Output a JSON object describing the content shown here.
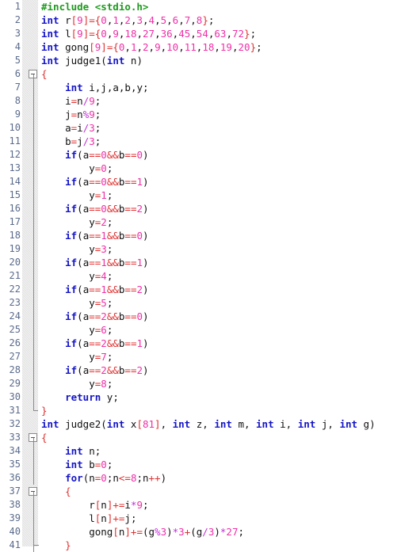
{
  "editor": {
    "app": "code-editor",
    "language": "C",
    "font_size_px": 12.5,
    "line_height_px": 17,
    "first_visible_line": 1,
    "last_visible_line": 41,
    "gutter": {
      "line_numbers": [
        1,
        2,
        3,
        4,
        5,
        6,
        7,
        8,
        9,
        10,
        11,
        12,
        13,
        14,
        15,
        16,
        17,
        18,
        19,
        20,
        21,
        22,
        23,
        24,
        25,
        26,
        27,
        28,
        29,
        30,
        31,
        32,
        33,
        34,
        35,
        36,
        37,
        38,
        39,
        40,
        41
      ],
      "fold_markers": [
        {
          "line": 6,
          "type": "collapse-box"
        },
        {
          "line": 31,
          "type": "fold-end"
        },
        {
          "line": 33,
          "type": "collapse-box"
        },
        {
          "line": 37,
          "type": "collapse-box"
        },
        {
          "line": 41,
          "type": "fold-tick"
        }
      ]
    },
    "colors": {
      "background": "#ffffff",
      "line_number": "#5b6b8c",
      "gutter_strip": "#f2f2f2",
      "keyword": "#1515c8",
      "preprocessor": "#1f9a1f",
      "number": "#ef2fa8",
      "bracket": "#e03030",
      "operator": "#e03030",
      "arith_operator": "#c22fd8",
      "identifier": "#101010",
      "fold_line": "#8a8a8a"
    },
    "lines": [
      {
        "n": 1,
        "text": "#include <stdio.h>"
      },
      {
        "n": 2,
        "text": "int r[9]={0,1,2,3,4,5,6,7,8};"
      },
      {
        "n": 3,
        "text": "int l[9]={0,9,18,27,36,45,54,63,72};"
      },
      {
        "n": 4,
        "text": "int gong[9]={0,1,2,9,10,11,18,19,20};"
      },
      {
        "n": 5,
        "text": "int judge1(int n)"
      },
      {
        "n": 6,
        "text": "{"
      },
      {
        "n": 7,
        "text": "    int i,j,a,b,y;"
      },
      {
        "n": 8,
        "text": "    i=n/9;"
      },
      {
        "n": 9,
        "text": "    j=n%9;"
      },
      {
        "n": 10,
        "text": "    a=i/3;"
      },
      {
        "n": 11,
        "text": "    b=j/3;"
      },
      {
        "n": 12,
        "text": "    if(a==0&&b==0)"
      },
      {
        "n": 13,
        "text": "        y=0;"
      },
      {
        "n": 14,
        "text": "    if(a==0&&b==1)"
      },
      {
        "n": 15,
        "text": "        y=1;"
      },
      {
        "n": 16,
        "text": "    if(a==0&&b==2)"
      },
      {
        "n": 17,
        "text": "        y=2;"
      },
      {
        "n": 18,
        "text": "    if(a==1&&b==0)"
      },
      {
        "n": 19,
        "text": "        y=3;"
      },
      {
        "n": 20,
        "text": "    if(a==1&&b==1)"
      },
      {
        "n": 21,
        "text": "        y=4;"
      },
      {
        "n": 22,
        "text": "    if(a==1&&b==2)"
      },
      {
        "n": 23,
        "text": "        y=5;"
      },
      {
        "n": 24,
        "text": "    if(a==2&&b==0)"
      },
      {
        "n": 25,
        "text": "        y=6;"
      },
      {
        "n": 26,
        "text": "    if(a==2&&b==1)"
      },
      {
        "n": 27,
        "text": "        y=7;"
      },
      {
        "n": 28,
        "text": "    if(a==2&&b==2)"
      },
      {
        "n": 29,
        "text": "        y=8;"
      },
      {
        "n": 30,
        "text": "    return y;"
      },
      {
        "n": 31,
        "text": "}"
      },
      {
        "n": 32,
        "text": "int judge2(int x[81], int z, int m, int i, int j, int g)"
      },
      {
        "n": 33,
        "text": "{"
      },
      {
        "n": 34,
        "text": "    int n;"
      },
      {
        "n": 35,
        "text": "    int b=0;"
      },
      {
        "n": 36,
        "text": "    for(n=0;n<=8;n++)"
      },
      {
        "n": 37,
        "text": "    {"
      },
      {
        "n": 38,
        "text": "        r[n]+=i*9;"
      },
      {
        "n": 39,
        "text": "        l[n]+=j;"
      },
      {
        "n": 40,
        "text": "        gong[n]+=(g%3)*3+(g/3)*27;"
      },
      {
        "n": 41,
        "text": "    }"
      }
    ]
  }
}
